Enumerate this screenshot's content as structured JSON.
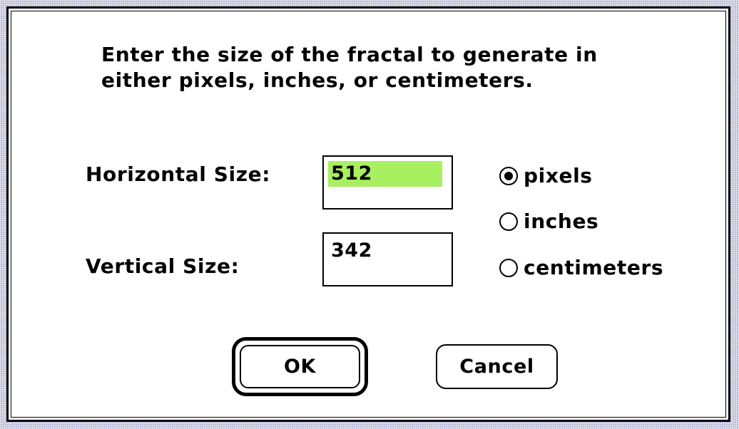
{
  "dialog": {
    "prompt": "Enter the size of the fractal to generate in\neither pixels, inches, or centimeters.",
    "horizontal": {
      "label": "Horizontal Size:",
      "value": "512",
      "selected": true
    },
    "vertical": {
      "label": "Vertical Size:",
      "value": "342"
    },
    "units": {
      "options": [
        "pixels",
        "inches",
        "centimeters"
      ],
      "selected": "pixels"
    },
    "buttons": {
      "ok": "OK",
      "cancel": "Cancel"
    },
    "colors": {
      "selection_highlight": "#a8f060",
      "desktop_pattern": "#b9bcd6"
    }
  }
}
